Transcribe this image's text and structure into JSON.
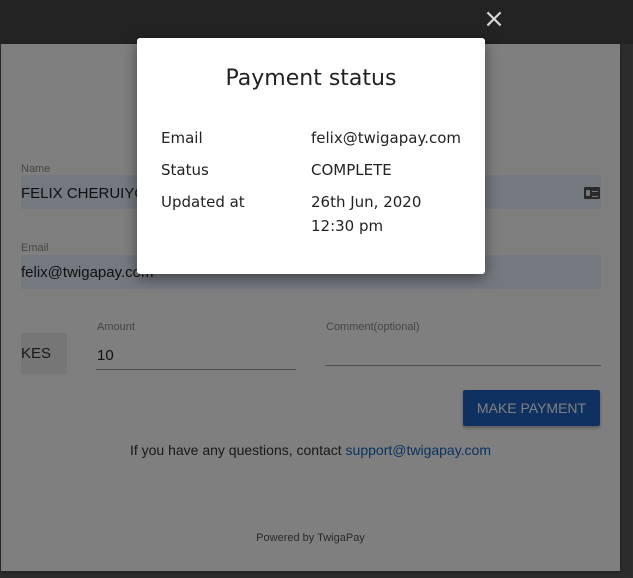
{
  "modal": {
    "title": "Payment status",
    "rows": [
      {
        "label": "Email",
        "value": "felix@twigapay.com"
      },
      {
        "label": "Status",
        "value": "COMPLETE"
      },
      {
        "label": "Updated at",
        "value_line1": "26th Jun, 2020",
        "value_line2": "12:30 pm"
      }
    ]
  },
  "close_icon": "×",
  "form": {
    "name_label": "Name",
    "name_value": "FELIX CHERUIYOT",
    "email_label": "Email",
    "email_value": "felix@twigapay.com",
    "currency": "KES",
    "amount_label": "Amount",
    "amount_value": "10",
    "comment_label": "Comment(optional)",
    "pay_button": "MAKE PAYMENT"
  },
  "footer": {
    "contact_text": "If you have any questions, contact ",
    "contact_email": "support@twigapay.com",
    "powered": "Powered by TwigaPay"
  },
  "colors": {
    "primary_button": "#1e62c4",
    "link": "#1565c0",
    "autofill_field": "#e8f0fe"
  }
}
